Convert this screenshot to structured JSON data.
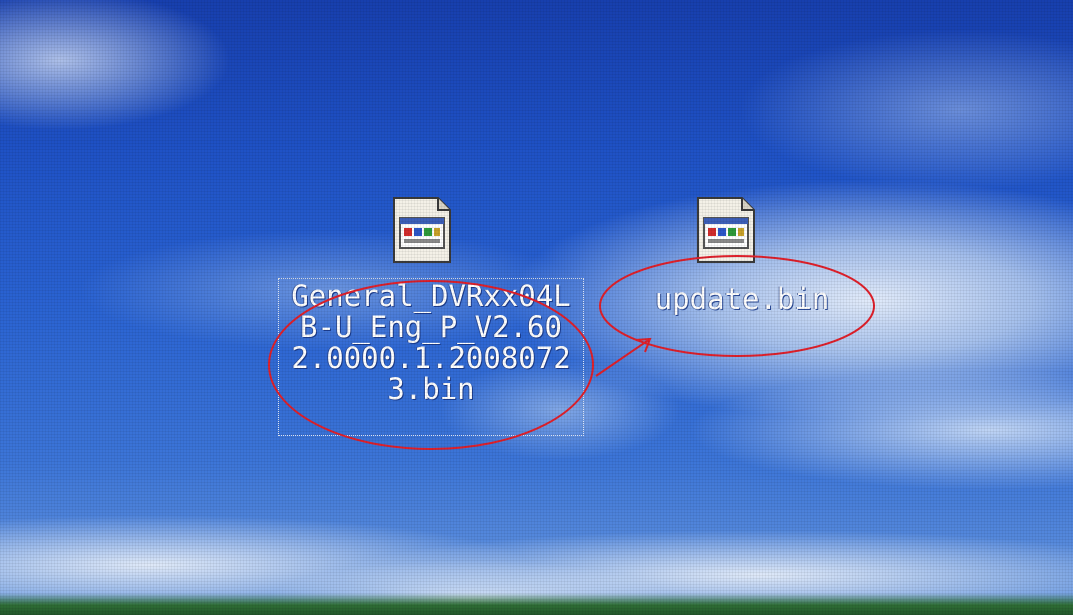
{
  "desktop": {
    "icons": [
      {
        "name": "General_DVRx x04LB-U_Eng_P_V2.602.0000.1.20080723.bin",
        "label": "General_DVRxx04LB-U_Eng_P_V2.602.0000.1.20080723.bin",
        "icon": "bin-file-icon",
        "selected": true
      },
      {
        "name": "update.bin",
        "label": "update.bin",
        "icon": "bin-file-icon",
        "selected": false
      }
    ]
  },
  "annotation": {
    "color": "#e0202a",
    "description_items": [
      "circle-around-first-file",
      "circle-around-second-file",
      "arrow-rename"
    ]
  },
  "colors": {
    "wallpaper_sky": "#2a63d2",
    "label_text": "#ffffff",
    "annotation_red": "#e0202a"
  }
}
